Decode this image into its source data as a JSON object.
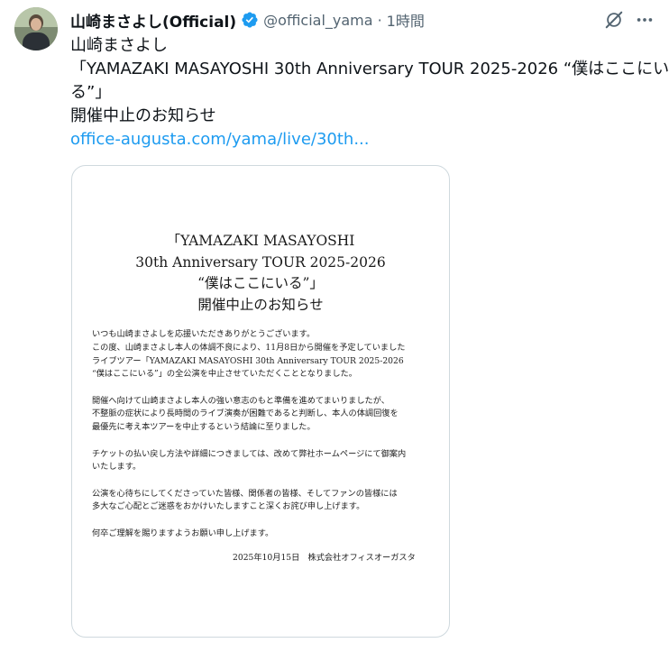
{
  "tweet": {
    "author_name": "山崎まさよし(Official)",
    "handle": "@official_yama",
    "separator": "·",
    "timestamp": "1時間",
    "text_lines": [
      "山崎まさよし",
      "「YAMAZAKI MASAYOSHI 30th Anniversary TOUR 2025-2026 “僕はここにい",
      "る”」",
      "開催中止のお知らせ"
    ],
    "link_text": "office-augusta.com/yama/live/30th...",
    "verified_icon": "verified-badge-icon",
    "actions": [
      "grok-icon",
      "more-options-icon"
    ]
  },
  "document": {
    "title_lines": [
      "「YAMAZAKI MASAYOSHI",
      "30th Anniversary TOUR 2025-2026",
      "“僕はここにいる”」",
      "開催中止のお知らせ"
    ],
    "paragraphs": [
      [
        "いつも山崎まさよしを応援いただきありがとうございます。",
        "この度、山崎まさよし本人の体調不良により、11月8日から開催を予定していました",
        "ライブツアー「YAMAZAKI MASAYOSHI 30th Anniversary TOUR 2025-2026",
        "“僕はここにいる”」の全公演を中止させていただくこととなりました。"
      ],
      [
        "開催へ向けて山崎まさよし本人の強い意志のもと準備を進めてまいりましたが、",
        "不整脈の症状により長時間のライブ演奏が困難であると判断し、本人の体調回復を",
        "最優先に考え本ツアーを中止するという結論に至りました。"
      ],
      [
        "チケットの払い戻し方法や詳細につきましては、改めて弊社ホームページにて御案内",
        "いたします。"
      ],
      [
        "公演を心待ちにしてくださっていた皆様、関係者の皆様、そしてファンの皆様には",
        "多大なご心配とご迷惑をおかけいたしますこと深くお詫び申し上げます。"
      ],
      [
        "何卒ご理解を賜りますようお願い申し上げます。"
      ]
    ],
    "signature": "2025年10月15日　株式会社オフィスオーガスタ"
  },
  "colors": {
    "link": "#1d9bf0",
    "secondary_text": "#536471",
    "border": "#cfd9de",
    "verified": "#1d9bf0"
  }
}
